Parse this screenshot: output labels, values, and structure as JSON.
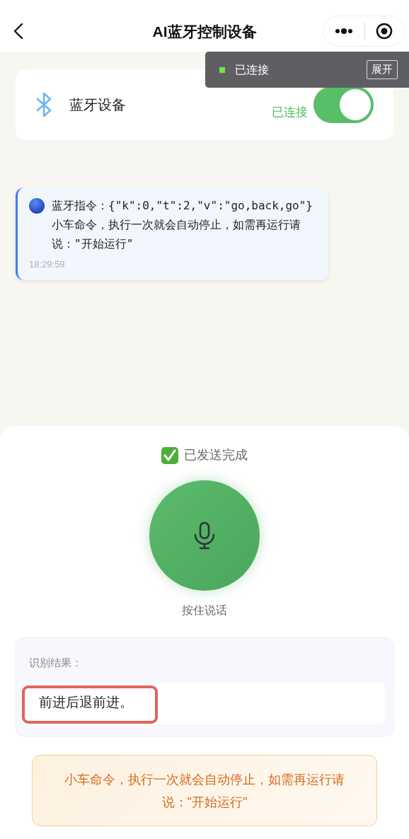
{
  "nav": {
    "title": "AI蓝牙控制设备"
  },
  "toast": {
    "status": "已连接",
    "connected": true,
    "button": "展开"
  },
  "device_card": {
    "name": "蓝牙设备",
    "status": "已连接",
    "on": true
  },
  "messages": [
    {
      "text": "蓝牙指令：{\"k\":0,\"t\":2,\"v\":\"go,back,go\"} 小车命令，执行一次就会自动停止，如需再运行请说：\"开始运行\"",
      "time": "18:29:59"
    }
  ],
  "send_status": "已发送完成",
  "mic_label": "按住说话",
  "result": {
    "label": "识别结果：",
    "text": "前进后退前进。",
    "highlighted": true
  },
  "tip": "小车命令，执行一次就会自动停止，如需再运行请说：\"开始运行\""
}
